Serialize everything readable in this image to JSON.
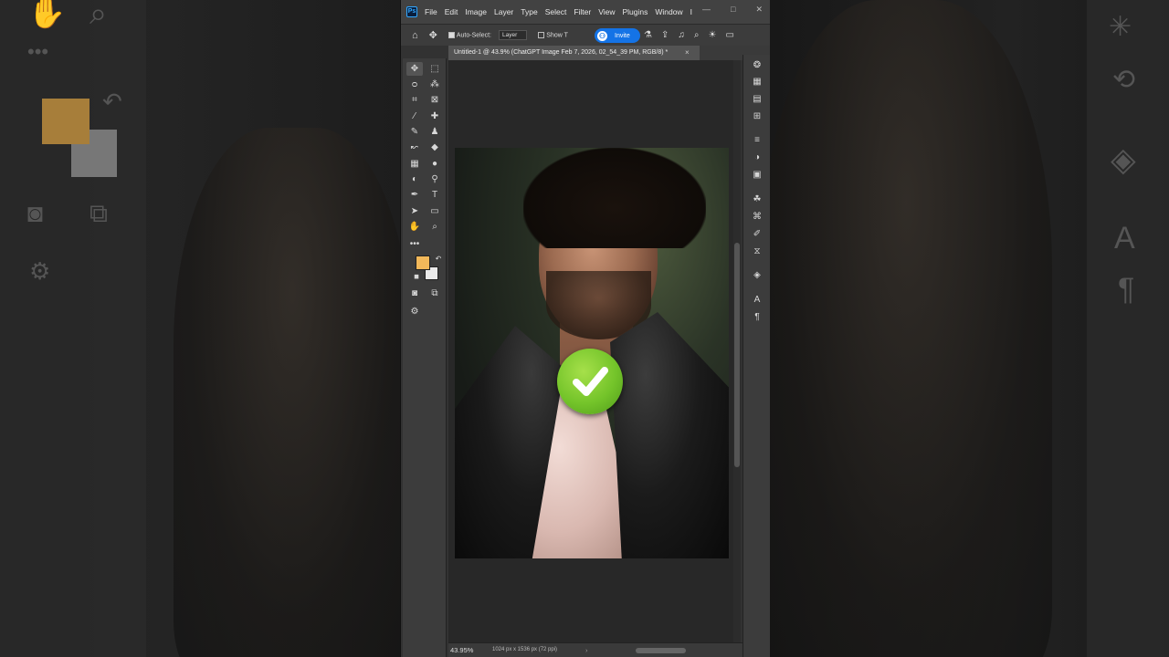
{
  "app": {
    "logo": "Ps",
    "menu": [
      "File",
      "Edit",
      "Image",
      "Layer",
      "Type",
      "Select",
      "Filter",
      "View",
      "Plugins",
      "Window",
      "I"
    ],
    "window_controls": {
      "minimize": "—",
      "maximize": "□",
      "close": "✕"
    }
  },
  "options_bar": {
    "auto_select_label": "Auto-Select:",
    "auto_select_value": "Layer",
    "show_transform_label": "Show T",
    "invite_label": "Invite",
    "invite_avatar": "⚇"
  },
  "document": {
    "tab_title": "Untitled-1 @ 43.9% (ChatGPT Image Feb 7, 2026, 02_54_39 PM, RGB/8) *",
    "tab_close": "×",
    "zoom": "43.95%",
    "doc_info": "1024 px x 1536 px (72 ppi)"
  },
  "colors": {
    "foreground": "#f2b85a",
    "background": "#eaeaea",
    "accent": "#1473e6",
    "check": "#74c42a"
  },
  "icons": {
    "tools": [
      "move-icon",
      "marquee-icon",
      "lasso-icon",
      "quick-select-icon",
      "crop-icon",
      "frame-icon",
      "eyedropper-icon",
      "healing-icon",
      "brush-icon",
      "stamp-icon",
      "history-brush-icon",
      "eraser-icon",
      "gradient-icon",
      "blur-icon",
      "dodge-icon",
      "sponge-icon",
      "pen-icon",
      "type-icon",
      "path-select-icon",
      "rectangle-icon",
      "hand-icon",
      "zoom-icon",
      "more-icon"
    ],
    "right_panel": [
      "color-icon",
      "swatches-icon",
      "gradients-icon",
      "patterns-icon",
      "adjustments-icon",
      "libraries-icon",
      "properties-icon",
      "channels-icon",
      "paths-icon",
      "brush-settings-icon",
      "history-icon",
      "layers-icon",
      "character-icon",
      "paragraph-icon"
    ]
  }
}
